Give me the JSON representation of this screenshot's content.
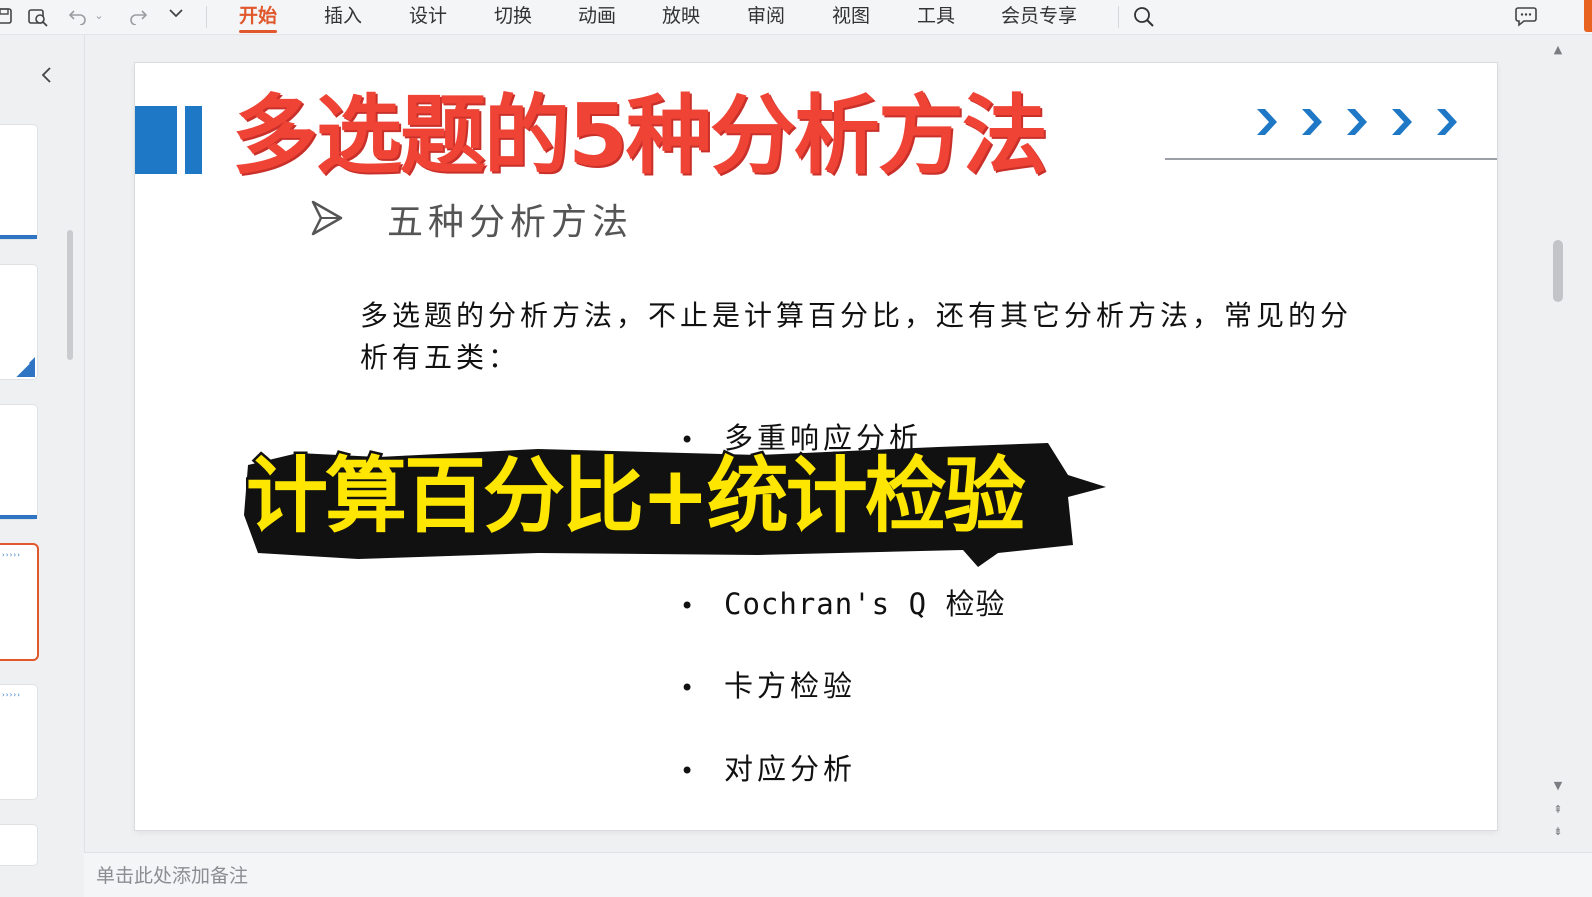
{
  "ribbon": {
    "tabs": [
      "开始",
      "插入",
      "设计",
      "切换",
      "动画",
      "放映",
      "审阅",
      "视图",
      "工具",
      "会员专享"
    ],
    "active_tab": "开始",
    "accent_color": "#e0582c"
  },
  "quick_access": {
    "icons": [
      "save-icon",
      "print-preview-icon",
      "undo-icon",
      "dropdown-icon",
      "redo-icon",
      "customize-dropdown-icon",
      "search-icon",
      "chat-bubble-icon"
    ]
  },
  "left_panel": {
    "collapse_icon": "chevron-left-icon"
  },
  "slide": {
    "subtitle": "五种分析方法",
    "intro": "多选题的分析方法，不止是计算百分比，还有其它分析方法，常见的分析有五类：",
    "bullets": [
      "多重响应分析",
      "",
      "Cochran's Q 检验",
      "卡方检验",
      "对应分析"
    ],
    "bullet_symbol": "•",
    "accent_color": "#1f78c6"
  },
  "overlay": {
    "title": "多选题的5种分析方法",
    "title_color": "#ef4435",
    "caption": "计算百分比+统计检验",
    "caption_color": "#ffe600"
  },
  "notes": {
    "placeholder": "单击此处添加备注"
  }
}
